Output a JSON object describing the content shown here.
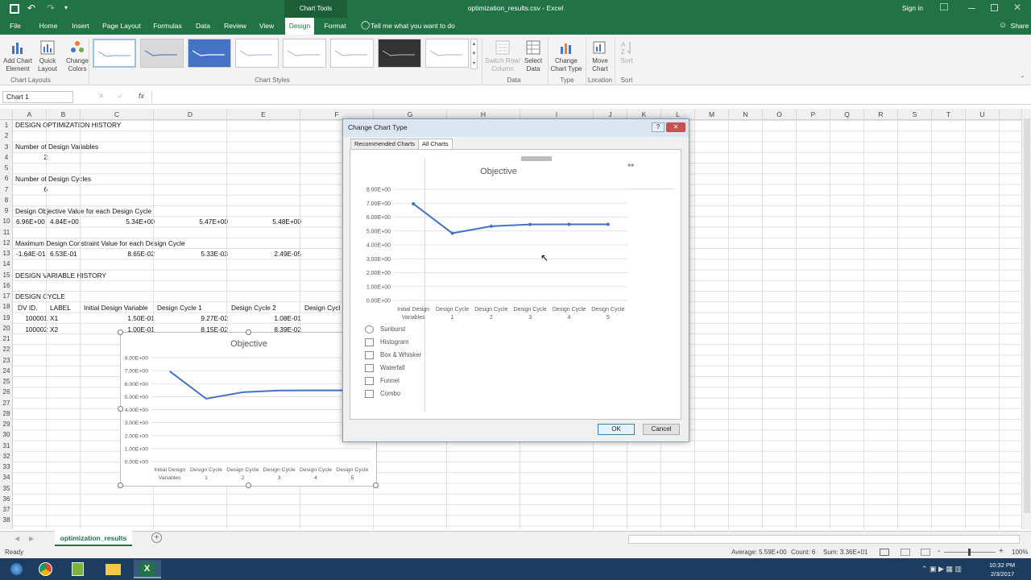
{
  "window": {
    "title": "optimization_results.csv - Excel",
    "signin": "Sign in",
    "share": "Share",
    "chart_tools": "Chart Tools"
  },
  "tabs": [
    "File",
    "Home",
    "Insert",
    "Page Layout",
    "Formulas",
    "Data",
    "Review",
    "View",
    "Design",
    "Format"
  ],
  "tell_me": "Tell me what you want to do",
  "ribbon": {
    "add_chart_element": [
      "Add Chart",
      "Element"
    ],
    "quick_layout": [
      "Quick",
      "Layout"
    ],
    "change_colors": [
      "Change",
      "Colors"
    ],
    "group_chart_layouts": "Chart Layouts",
    "group_chart_styles": "Chart Styles",
    "switch_row_col": [
      "Switch Row/",
      "Column"
    ],
    "select_data": [
      "Select",
      "Data"
    ],
    "group_data": "Data",
    "change_chart_type": [
      "Change",
      "Chart Type"
    ],
    "group_type": "Type",
    "move_chart": [
      "Move",
      "Chart"
    ],
    "group_location": "Location",
    "sort": "Sort",
    "group_sort": "Sort"
  },
  "namebox": "Chart 1",
  "columns": [
    "A",
    "B",
    "C",
    "D",
    "E",
    "F",
    "G",
    "H",
    "I",
    "J",
    "K",
    "L",
    "M",
    "N",
    "O",
    "P",
    "Q",
    "R",
    "S",
    "T",
    "U"
  ],
  "rows": [
    "1",
    "2",
    "3",
    "4",
    "5",
    "6",
    "7",
    "8",
    "9",
    "10",
    "11",
    "12",
    "13",
    "14",
    "15",
    "16",
    "17",
    "18",
    "19",
    "20",
    "21",
    "22",
    "23",
    "24",
    "25",
    "26",
    "27",
    "28",
    "29",
    "30",
    "31",
    "32",
    "33",
    "34",
    "35",
    "36",
    "37",
    "38"
  ],
  "cells": {
    "r1": "DESIGN OPTIMIZATION HISTORY",
    "r3": "Number of Design Variables",
    "r4": "2",
    "r6": "Number of Design Cycles",
    "r7": "6",
    "r9": "Design Objective Value for each Design Cycle",
    "r10": [
      "6.96E+00",
      "4.84E+00",
      "5.34E+00",
      "5.47E+00",
      "5.48E+00"
    ],
    "r12": "Maximum Design Constraint Value for each Design Cycle",
    "r13": [
      "-1.64E-01",
      "6.53E-01",
      "8.65E-02",
      "5.33E-03",
      "2.49E-05"
    ],
    "r15": "DESIGN VARIABLE HISTORY",
    "r17": "DESIGN CYCLE",
    "r18": [
      "DV ID.",
      "LABEL",
      "Initial Design Variable",
      "Design Cycle 1",
      "Design Cycle 2",
      "Design Cycl"
    ],
    "r19": [
      "100001",
      "X1",
      "1.50E-01",
      "9.27E-02",
      "1.08E-01"
    ],
    "r20": [
      "100002",
      "X2",
      "1.00E-01",
      "8.15E-02",
      "8.39E-02"
    ]
  },
  "sheet_tab": "optimization_results",
  "status": {
    "ready": "Ready",
    "average": "Average: 5.59E+00",
    "count": "Count: 6",
    "sum": "Sum: 3.36E+01",
    "zoom": "100%"
  },
  "clock": {
    "time": "10:32 PM",
    "date": "2/3/2017"
  },
  "dialog": {
    "title": "Change Chart Type",
    "tab_recommended": "Recommended Charts",
    "tab_all": "All Charts",
    "chart_types": [
      "Sunburst",
      "Histogram",
      "Box & Whisker",
      "Waterfall",
      "Funnel",
      "Combo"
    ],
    "ok": "OK",
    "cancel": "Cancel"
  },
  "chart_data": {
    "type": "line",
    "title": "Objective",
    "categories": [
      "Initial Design Variables",
      "Design Cycle 1",
      "Design Cycle 2",
      "Design Cycle 3",
      "Design Cycle 4",
      "Design Cycle 5"
    ],
    "category_lines": [
      [
        "Initial Design",
        "Variables"
      ],
      [
        "Design Cycle",
        "1"
      ],
      [
        "Design Cycle",
        "2"
      ],
      [
        "Design Cycle",
        "3"
      ],
      [
        "Design Cycle",
        "4"
      ],
      [
        "Design Cycle",
        "5"
      ]
    ],
    "values": [
      6.96,
      4.84,
      5.34,
      5.47,
      5.48,
      5.48
    ],
    "ylim": [
      0,
      8
    ],
    "yticks": [
      "0.00E+00",
      "1.00E+00",
      "2.00E+00",
      "3.00E+00",
      "4.00E+00",
      "5.00E+00",
      "6.00E+00",
      "7.00E+00",
      "8.00E+00"
    ],
    "line_color": "#4472c4",
    "grid": true
  },
  "colors": {
    "excel_green": "#217346",
    "taskbar": "#1c3d5e"
  }
}
